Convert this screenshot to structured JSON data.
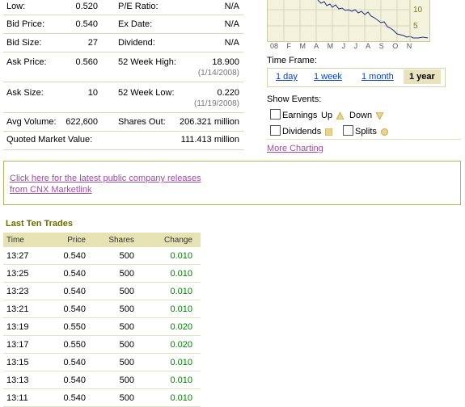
{
  "quote": {
    "rows": [
      {
        "l1": "Low:",
        "v1": "0.520",
        "l2": "P/E Ratio:",
        "v2": "N/A"
      },
      {
        "l1": "Bid Price:",
        "v1": "0.540",
        "l2": "Ex Date:",
        "v2": "N/A"
      },
      {
        "l1": "Bid Size:",
        "v1": "27",
        "l2": "Dividend:",
        "v2": "N/A"
      },
      {
        "l1": "Ask Price:",
        "v1": "0.560",
        "l2": "52 Week High:",
        "v2": "18.900",
        "sub": "(1/14/2008)"
      },
      {
        "l1": "Ask Size:",
        "v1": "10",
        "l2": "52 Week Low:",
        "v2": "0.220",
        "sub": "(11/19/2008)"
      },
      {
        "l1": "Avg Volume:",
        "v1": "622,600",
        "l2": "Shares Out:",
        "v2": "206.321 million"
      },
      {
        "l1": "Quoted Market Value:",
        "v1": "",
        "l2": "",
        "v2": "111.413 million"
      }
    ]
  },
  "chart": {
    "y_ticks": [
      "10",
      "5"
    ],
    "x_labels": [
      "08",
      "F",
      "M",
      "A",
      "M",
      "J",
      "J",
      "A",
      "S",
      "O",
      "N"
    ]
  },
  "time_frame": {
    "label": "Time Frame:",
    "options": [
      "1 day",
      "1 week",
      "1 month",
      "1 year"
    ],
    "selected": "1 year"
  },
  "events": {
    "label": "Show Events:",
    "earnings": "Earnings",
    "up": "Up",
    "down": "Down",
    "dividends": "Dividends",
    "splits": "Splits"
  },
  "more_charting": "More Charting",
  "release": {
    "line1": "Click here for the latest public company releases",
    "line2": "from CNX Marketlink"
  },
  "trades": {
    "title": "Last Ten Trades",
    "headers": {
      "time": "Time",
      "price": "Price",
      "shares": "Shares",
      "change": "Change"
    },
    "rows": [
      {
        "time": "13:27",
        "price": "0.540",
        "shares": "500",
        "change": "0.010"
      },
      {
        "time": "13:25",
        "price": "0.540",
        "shares": "500",
        "change": "0.010"
      },
      {
        "time": "13:23",
        "price": "0.540",
        "shares": "500",
        "change": "0.010"
      },
      {
        "time": "13:21",
        "price": "0.540",
        "shares": "500",
        "change": "0.010"
      },
      {
        "time": "13:19",
        "price": "0.550",
        "shares": "500",
        "change": "0.020"
      },
      {
        "time": "13:17",
        "price": "0.550",
        "shares": "500",
        "change": "0.020"
      },
      {
        "time": "13:15",
        "price": "0.540",
        "shares": "500",
        "change": "0.010"
      },
      {
        "time": "13:13",
        "price": "0.540",
        "shares": "500",
        "change": "0.010"
      },
      {
        "time": "13:11",
        "price": "0.540",
        "shares": "500",
        "change": "0.010"
      }
    ]
  },
  "colors": {
    "link": "#0a3ec0",
    "visited_link": "#a04aa6",
    "positive_change": "#008000",
    "header_bg": "#e6e2b4"
  }
}
